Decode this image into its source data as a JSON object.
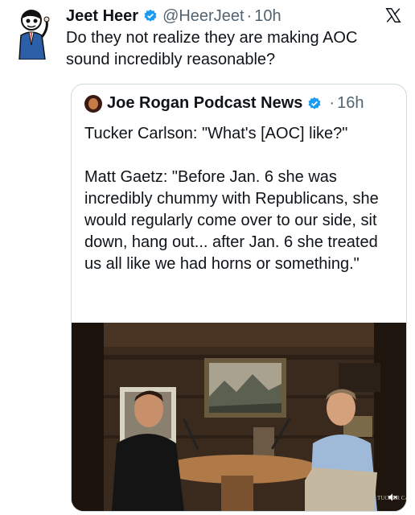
{
  "tweet": {
    "author_name": "Jeet Heer",
    "handle": "@HeerJeet",
    "separator": "·",
    "time": "10h",
    "text": "Do they not realize they are making AOC sound incredibly reasonable?"
  },
  "quoted": {
    "author_name": "Joe Rogan Podcast News",
    "separator": "·",
    "time": "16h",
    "text": "Tucker Carlson: \"What's [AOC] like?\"\n\nMatt Gaetz: \"Before Jan. 6 she was incredibly chummy with Republicans, she would regularly come over to our side, sit down, hang out... after Jan. 6 she treated us all like we had horns or something.\"",
    "media_watermark": "TUCKER CARLSON"
  },
  "icons": {
    "verified": "verified-badge-icon",
    "platform": "x-logo-icon",
    "mute": "speaker-muted-icon"
  },
  "colors": {
    "verified_blue": "#1d9bf0",
    "secondary_text": "#536471",
    "border": "#cfd9de"
  }
}
